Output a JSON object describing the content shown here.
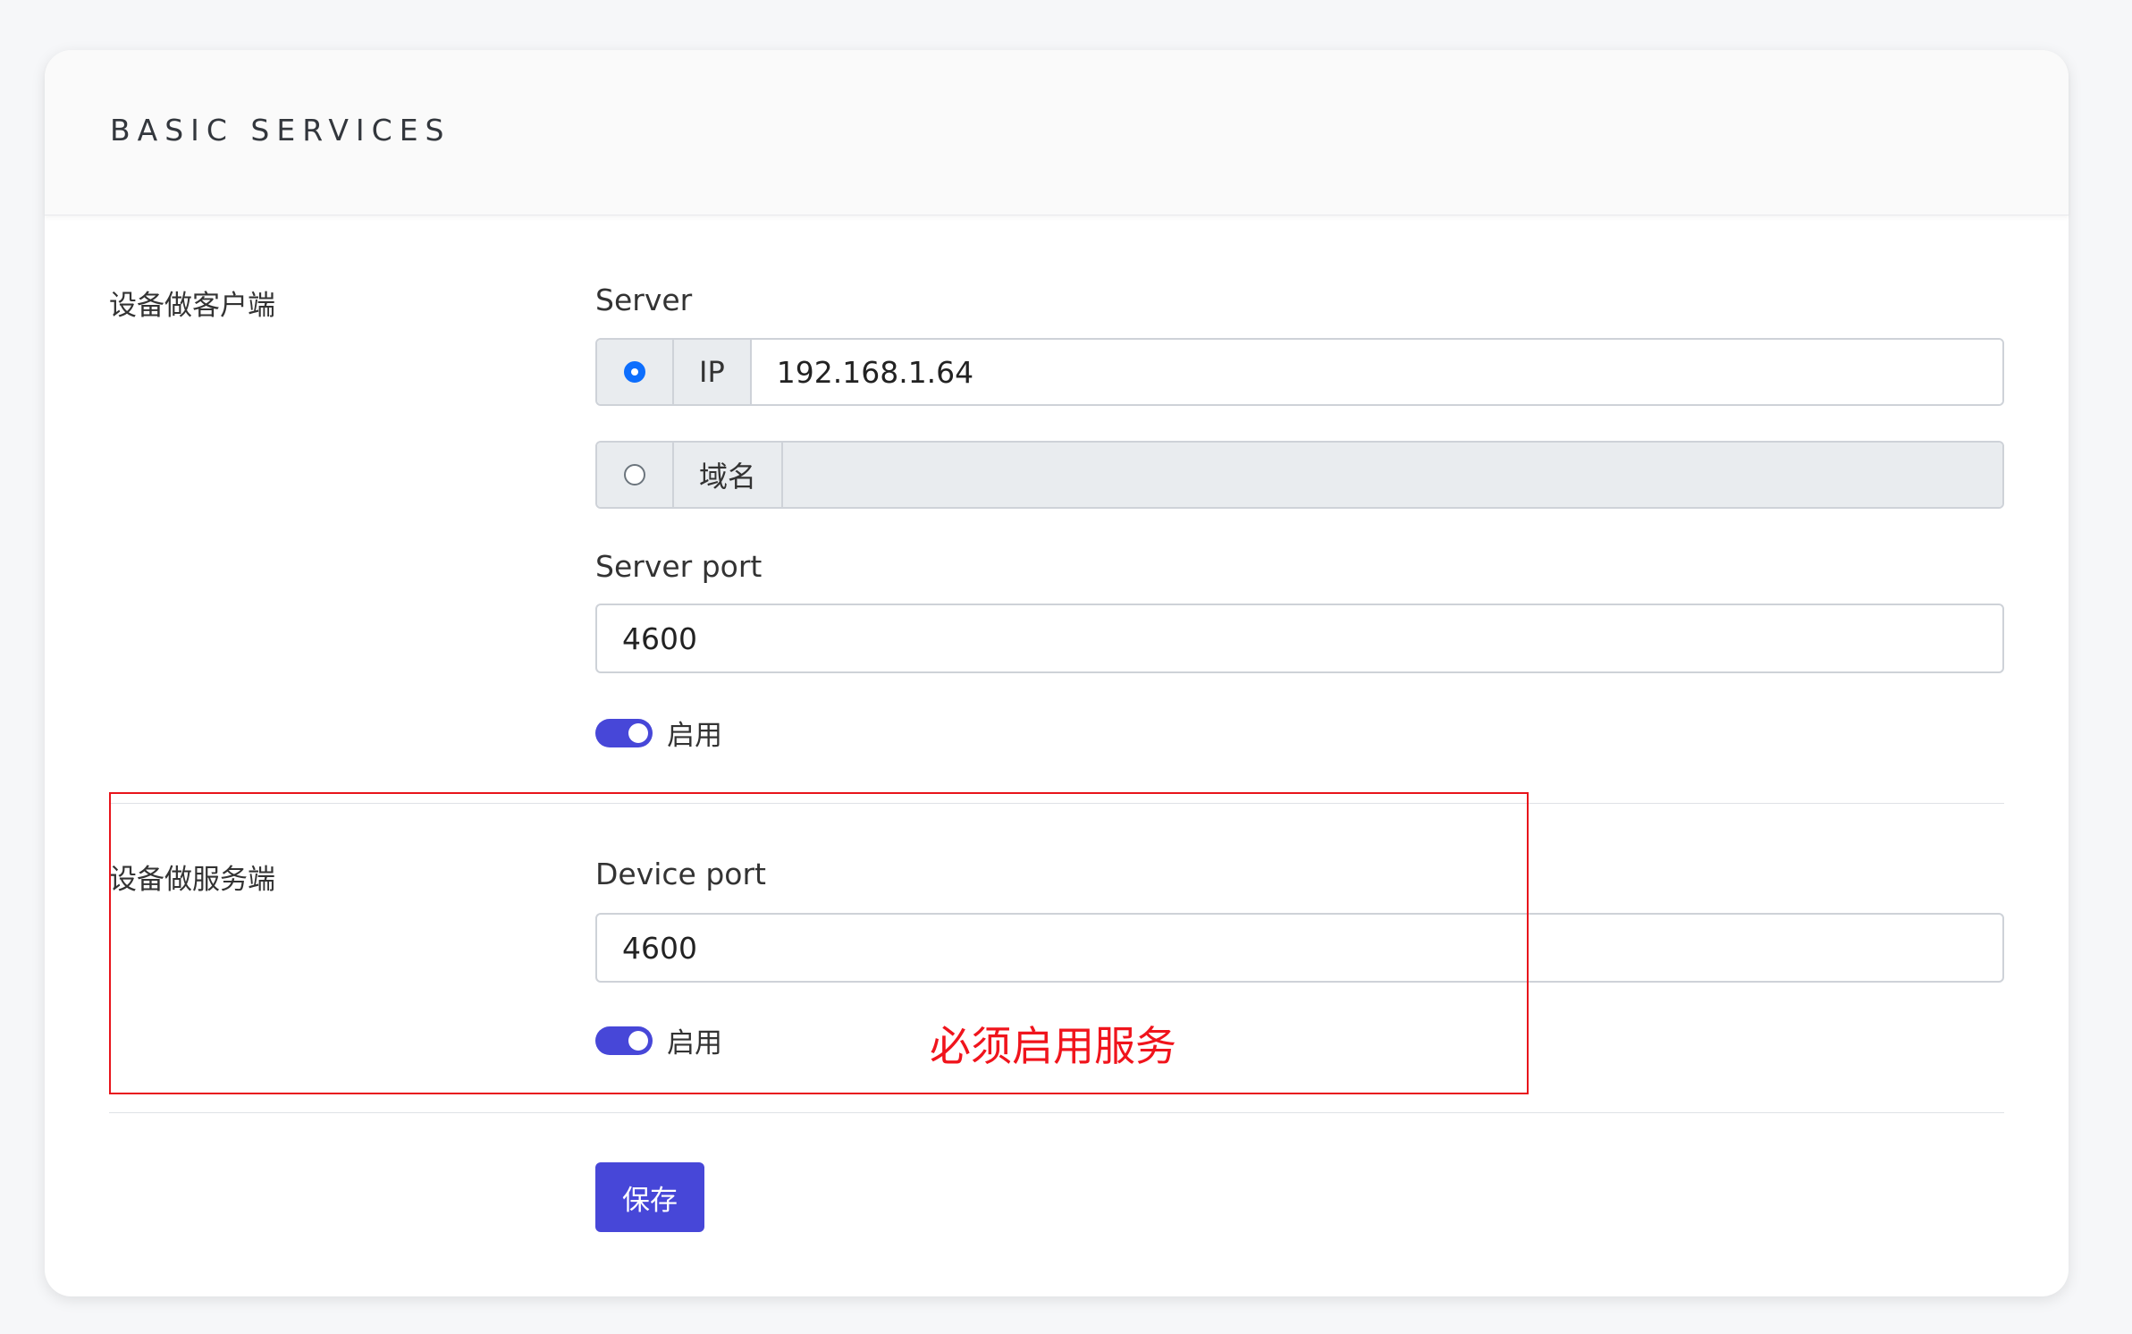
{
  "header": {
    "title": "BASIC SERVICES"
  },
  "client_section": {
    "label": "设备做客户端",
    "server_label": "Server",
    "ip_option": {
      "label": "IP",
      "value": "192.168.1.64",
      "selected": true
    },
    "domain_option": {
      "label": "域名",
      "value": "",
      "selected": false
    },
    "server_port_label": "Server port",
    "server_port_value": "4600",
    "enable_label": "启用",
    "enabled": true
  },
  "server_section": {
    "label": "设备做服务端",
    "device_port_label": "Device port",
    "device_port_value": "4600",
    "enable_label": "启用",
    "enabled": true
  },
  "annotation": {
    "text": "必须启用服务",
    "color": "#f0141c"
  },
  "actions": {
    "save_label": "保存"
  },
  "colors": {
    "accent": "#4747d8",
    "radio_checked": "#0d6efd"
  },
  "icons": {
    "ip_radio": "radio-checked-icon",
    "domain_radio": "radio-unchecked-icon"
  }
}
